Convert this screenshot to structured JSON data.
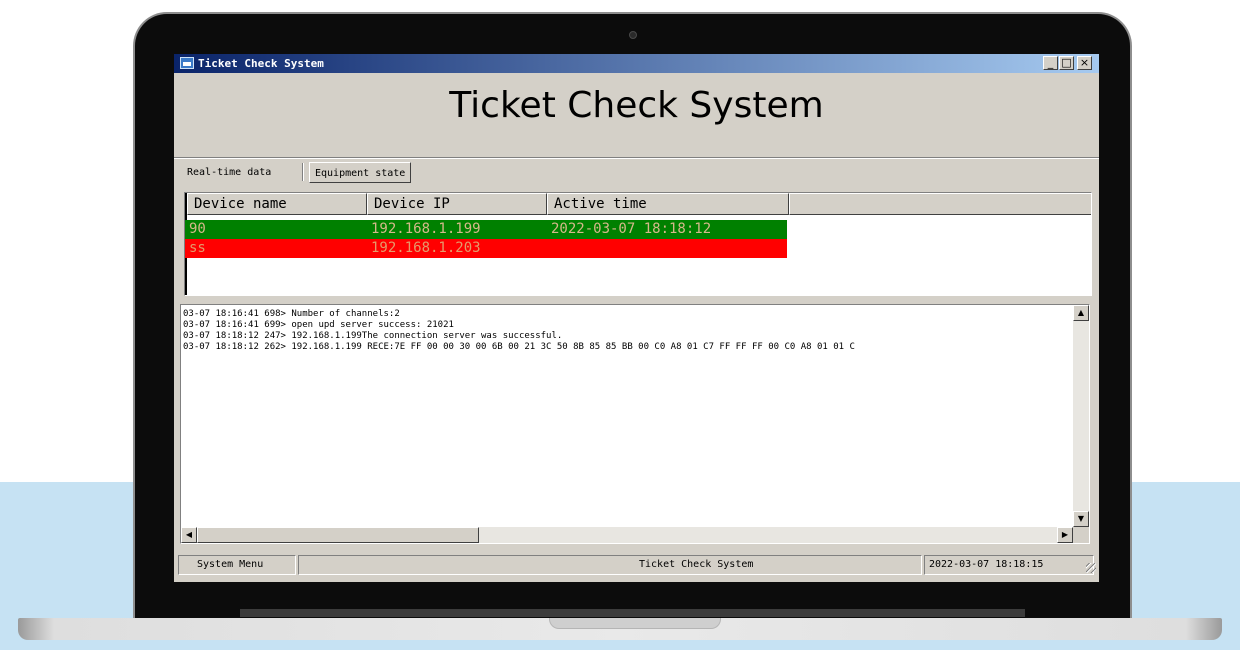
{
  "window": {
    "title": "Ticket Check System",
    "controls": {
      "minimize": "_",
      "maximize": "□",
      "close": "×"
    }
  },
  "header": {
    "title": "Ticket Check System"
  },
  "tabs": [
    {
      "label": "Real-time data",
      "active": false
    },
    {
      "label": "Equipment state",
      "active": true
    }
  ],
  "device_table": {
    "columns": [
      "Device name",
      "Device IP",
      "Active time"
    ],
    "rows": [
      {
        "name": "90",
        "ip": "192.168.1.199",
        "active_time": "2022-03-07 18:18:12",
        "status_color": "#008000",
        "text_color": "#d5b88a"
      },
      {
        "name": "ss",
        "ip": "192.168.1.203",
        "active_time": "",
        "status_color": "#ff0000",
        "text_color": "#e49a6a"
      }
    ]
  },
  "log": {
    "lines": [
      "03-07 18:16:41 698> Number of channels:2",
      "03-07 18:16:41 699> open upd server success: 21021",
      "03-07 18:18:12 247> 192.168.1.199The connection server was successful.",
      "03-07 18:18:12 262> 192.168.1.199 RECE:7E FF 00 00 30 00 6B 00 21 3C 50 8B 85 85 BB 00 C0 A8 01 C7 FF FF FF 00 C0 A8 01 01 C"
    ]
  },
  "statusbar": {
    "menu": "System Menu",
    "center": "Ticket Check System",
    "datetime": "2022-03-07 18:18:15"
  }
}
